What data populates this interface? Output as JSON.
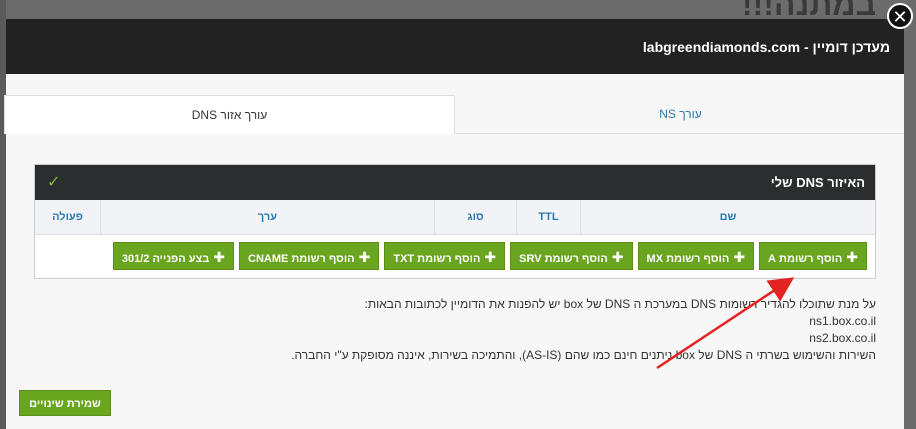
{
  "background": {
    "title": "במתנה!!!"
  },
  "modal": {
    "title": "מעדכן דומיין - labgreendiamonds.com",
    "close_symbol": "✕"
  },
  "tabs": [
    {
      "label": "עורך NS",
      "active": false
    },
    {
      "label": "עורך אזור DNS",
      "active": true
    }
  ],
  "zone": {
    "title": "האיזור DNS שלי",
    "check_symbol": "✓",
    "columns": [
      "שם",
      "TTL",
      "סוג",
      "ערך",
      "פעולה"
    ],
    "buttons": [
      "הוסף רשומת A",
      "הוסף רשומת MX",
      "הוסף רשומת SRV",
      "הוסף רשומת TXT",
      "הוסף רשומת CNAME",
      "בצע הפנייה 301/2"
    ]
  },
  "info": {
    "line1": "על מנת שתוכלו להגדיר רשומות DNS במערכת ה DNS של box יש להפנות את הדומיין לכתובות הבאות:",
    "ns1": "ns1.box.co.il",
    "ns2": "ns2.box.co.il",
    "line4": "השירות והשימוש בשרתי ה DNS של box ניתנים חינם כמו שהם (AS-IS), והתמיכה בשירות, איננה מסופקת ע\"י החברה."
  },
  "save_button": "שמירת שינויים",
  "colors": {
    "green": "#6aa51f",
    "header": "#222222",
    "link": "#2a7ab0",
    "arrow": "#e32222"
  }
}
